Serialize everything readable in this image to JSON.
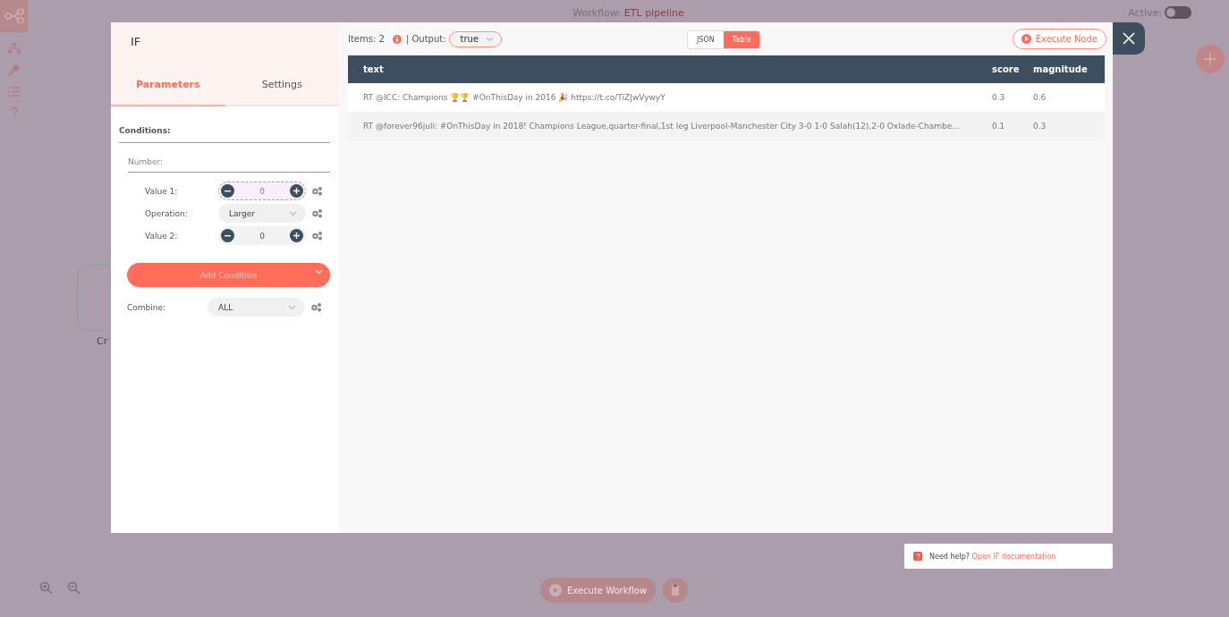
{
  "topbar": {
    "workflow_label": "Workflow:",
    "workflow_name": "ETL pipeline",
    "active_label": "Active:",
    "active_on": false
  },
  "canvas_node": {
    "label": "Cr"
  },
  "bottom": {
    "execute_workflow": "Execute Workflow"
  },
  "modal": {
    "title": "IF",
    "tabs": [
      {
        "label": "Parameters",
        "selected": true
      },
      {
        "label": "Settings",
        "selected": false
      }
    ],
    "conditions_label": "Conditions:",
    "number_label": "Number:",
    "params": [
      {
        "kind": "number",
        "label": "Value 1:",
        "value": "0",
        "focused": true
      },
      {
        "kind": "select",
        "label": "Operation:",
        "value": "Larger"
      },
      {
        "kind": "number",
        "label": "Value 2:",
        "value": "0",
        "focused": false
      }
    ],
    "add_condition": "Add Condition",
    "combine": {
      "label": "Combine:",
      "value": "ALL"
    },
    "items_label": "Items: 2",
    "output_label": "| Output:",
    "output_value": "true",
    "views": [
      {
        "label": "JSON",
        "selected": false
      },
      {
        "label": "Table",
        "selected": true
      }
    ],
    "execute_node": "Execute Node",
    "table": {
      "columns": [
        "text",
        "score",
        "magnitude"
      ],
      "rows": [
        [
          "RT @ICC: Champions 🏆🏆 #OnThisDay in 2016 🎉 https://t.co/TiZJwVywyY",
          "0.3",
          "0.6"
        ],
        [
          "RT @forever96juli: #OnThisDay in 2018! Champions League,quarter-final,1st leg Liverpool-Manchester City 3-0 1-0 Salah(12),2-0 Oxlade-Chambe…",
          "0.1",
          "0.3"
        ]
      ]
    }
  },
  "help": {
    "prefix": "Need help?",
    "link": "Open IF documentation"
  }
}
